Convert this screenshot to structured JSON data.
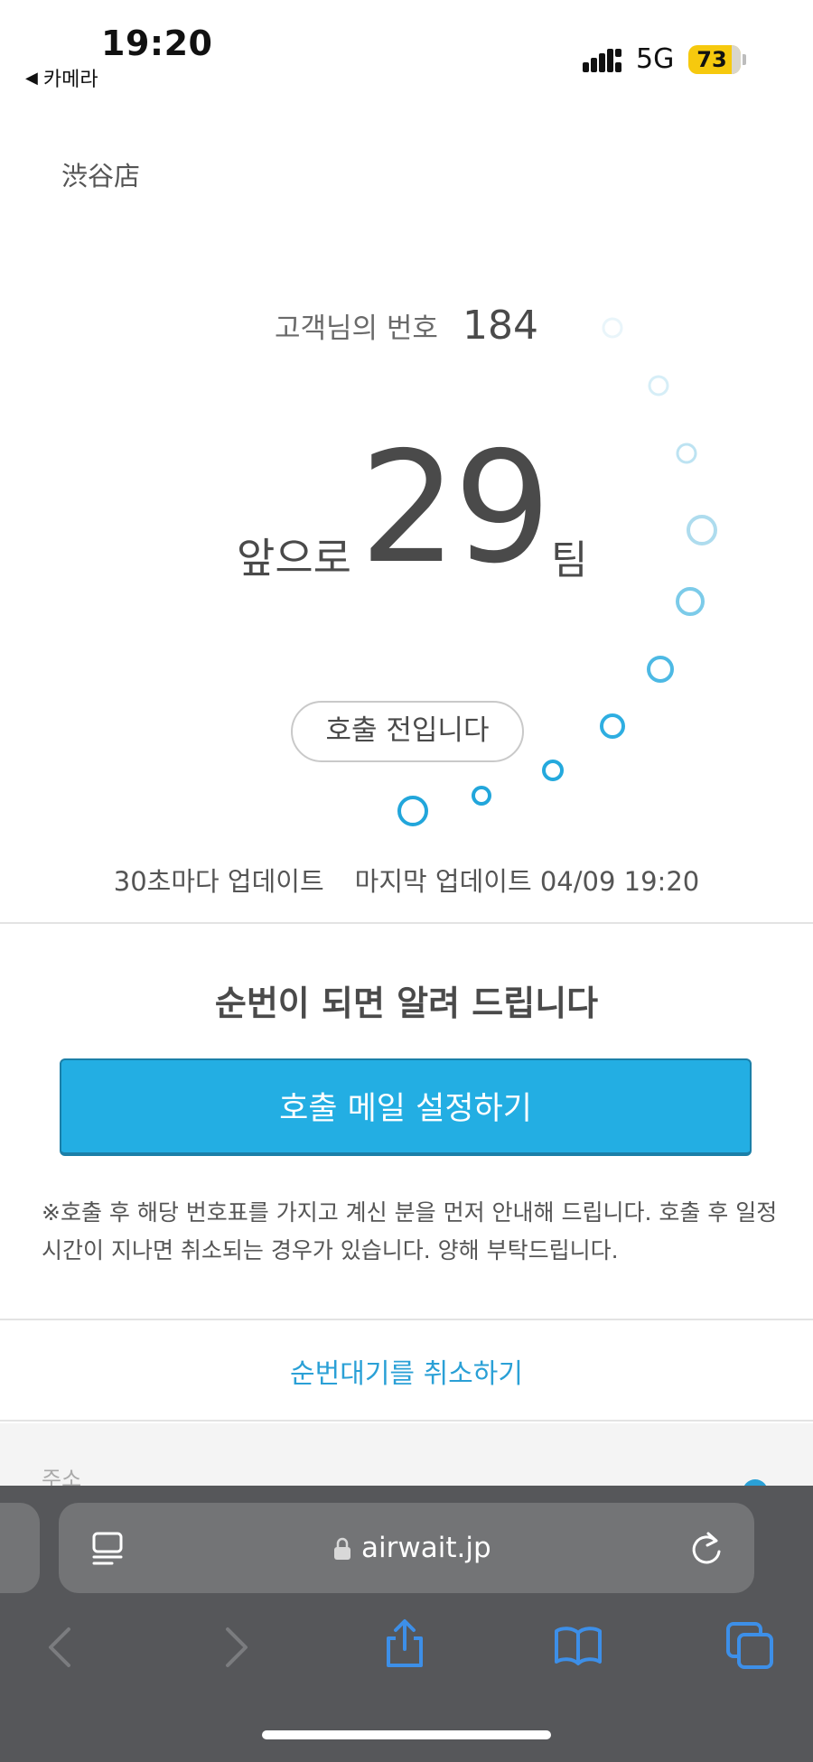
{
  "status_bar": {
    "time": "19:20",
    "back_app": "카메라",
    "network": "5G",
    "battery": "73"
  },
  "store": {
    "name": "渋谷店"
  },
  "queue": {
    "ticket_label": "고객님의 번호",
    "ticket_number": "184",
    "ahead_prefix": "앞으로",
    "ahead_count": "29",
    "ahead_suffix": "팀",
    "status": "호출 전입니다"
  },
  "update": {
    "interval": "30초마다 업데이트",
    "last_label": "마지막 업데이트",
    "last_time": "04/09 19:20"
  },
  "notify": {
    "title": "순번이 되면 알려 드립니다",
    "button": "호출 메일 설정하기",
    "notice": "※호출 후 해당 번호표를 가지고 계신 분을 먼저 안내해 드립니다. 호출 후 일정 시간이 지나면 취소되는 경우가 있습니다. 양해 부탁드립니다."
  },
  "cancel": {
    "label": "순번대기를 취소하기"
  },
  "address": {
    "label": "주소"
  },
  "browser": {
    "url": "airwait.jp"
  },
  "colors": {
    "accent": "#23aee3",
    "link": "#2aa0d6",
    "battery": "#f6c90e",
    "browser_bar": "#56575a"
  },
  "icons": {
    "reader": "reader-icon",
    "lock": "lock-icon",
    "reload": "reload-icon",
    "back": "back-icon",
    "forward": "forward-icon",
    "share": "share-icon",
    "bookmarks": "bookmarks-icon",
    "tabs": "tabs-icon"
  }
}
